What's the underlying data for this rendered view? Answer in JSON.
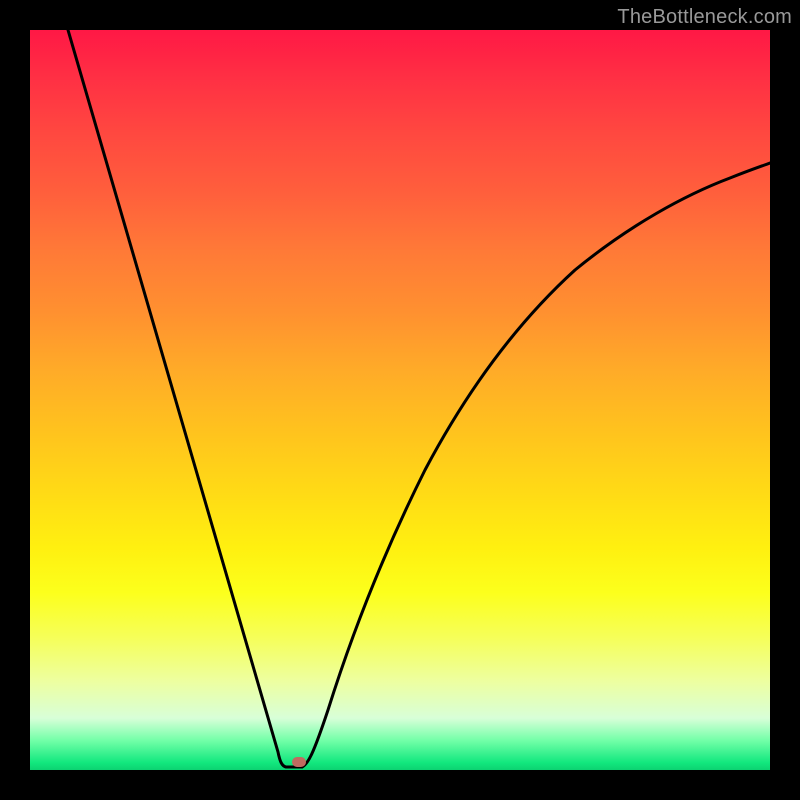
{
  "watermark": "TheBottleneck.com",
  "chart_data": {
    "type": "line",
    "title": "",
    "xlabel": "",
    "ylabel": "",
    "xlim": [
      0,
      100
    ],
    "ylim": [
      0,
      100
    ],
    "background": "gradient red-yellow-green vertical",
    "marker": {
      "x": 35,
      "y": 0,
      "color": "#c06b60"
    },
    "curve_left": [
      {
        "x": 5,
        "y": 100
      },
      {
        "x": 10,
        "y": 82
      },
      {
        "x": 15,
        "y": 65
      },
      {
        "x": 20,
        "y": 48
      },
      {
        "x": 25,
        "y": 32
      },
      {
        "x": 30,
        "y": 16
      },
      {
        "x": 33,
        "y": 3
      },
      {
        "x": 34,
        "y": 1
      }
    ],
    "curve_right": [
      {
        "x": 37,
        "y": 1
      },
      {
        "x": 40,
        "y": 11
      },
      {
        "x": 45,
        "y": 26
      },
      {
        "x": 50,
        "y": 38
      },
      {
        "x": 55,
        "y": 48
      },
      {
        "x": 60,
        "y": 56
      },
      {
        "x": 65,
        "y": 62
      },
      {
        "x": 70,
        "y": 67
      },
      {
        "x": 75,
        "y": 71
      },
      {
        "x": 80,
        "y": 74
      },
      {
        "x": 85,
        "y": 77
      },
      {
        "x": 90,
        "y": 79
      },
      {
        "x": 95,
        "y": 81
      },
      {
        "x": 100,
        "y": 82
      }
    ],
    "note": "Values read visually; y=0 at bottom, y=100 at top; x axis arbitrary 0-100."
  }
}
